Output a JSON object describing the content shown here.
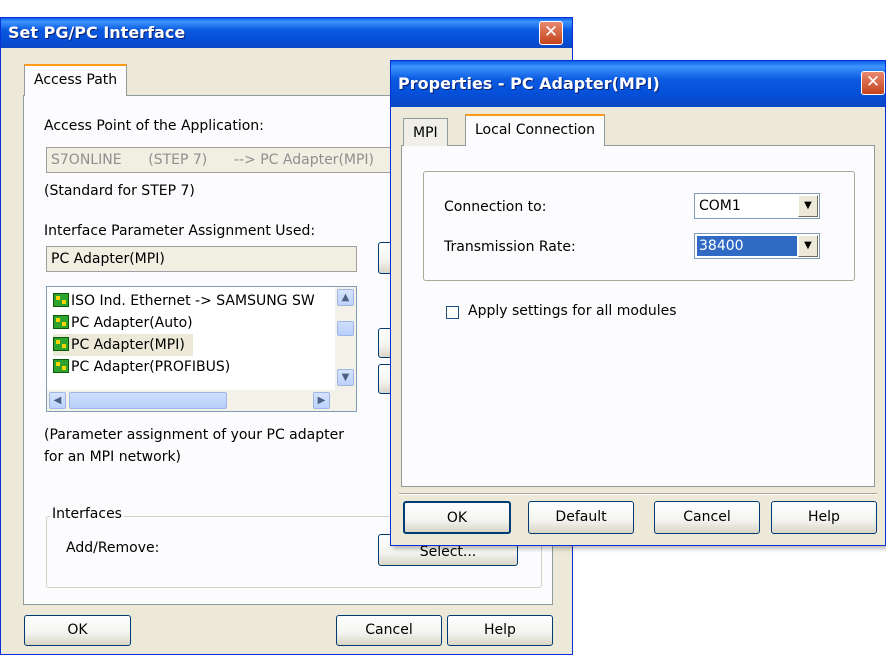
{
  "set_pgpc": {
    "title": "Set PG/PC Interface",
    "tab_access_path": "Access Path",
    "access_point_label": "Access Point of the Application:",
    "access_point_value": "S7ONLINE      (STEP 7)      --> PC Adapter(MPI)",
    "standard_note": "(Standard for STEP 7)",
    "interface_param_label": "Interface Parameter Assignment Used:",
    "interface_param_value": "PC Adapter(MPI)",
    "list_items": [
      "ISO Ind. Ethernet -> SAMSUNG SW",
      "PC Adapter(Auto)",
      "PC Adapter(MPI)",
      "PC Adapter(PROFIBUS)"
    ],
    "selected_item_index": 2,
    "description_line1": "(Parameter assignment of your PC adapter",
    "description_line2": "for an MPI network)",
    "interfaces_group": "Interfaces",
    "add_remove_label": "Add/Remove:",
    "select_button": "Select...",
    "ok_button": "OK",
    "cancel_button": "Cancel",
    "help_button": "Help"
  },
  "properties": {
    "title": "Properties - PC Adapter(MPI)",
    "tab_mpi": "MPI",
    "tab_local_connection": "Local Connection",
    "connection_to_label": "Connection to:",
    "connection_to_value": "COM1",
    "transmission_rate_label": "Transmission Rate:",
    "transmission_rate_value": "38400",
    "apply_settings_label": "Apply settings for all modules",
    "apply_settings_checked": false,
    "ok_button": "OK",
    "default_button": "Default",
    "cancel_button": "Cancel",
    "help_button": "Help"
  },
  "icons": {
    "close": "close-x-icon",
    "interface_item": "network-adapter-icon"
  },
  "colors": {
    "titlebar": "#0a5ae0",
    "tab_highlight": "#ff9a18",
    "selection": "#316ac5",
    "close_button": "#d4552e"
  }
}
